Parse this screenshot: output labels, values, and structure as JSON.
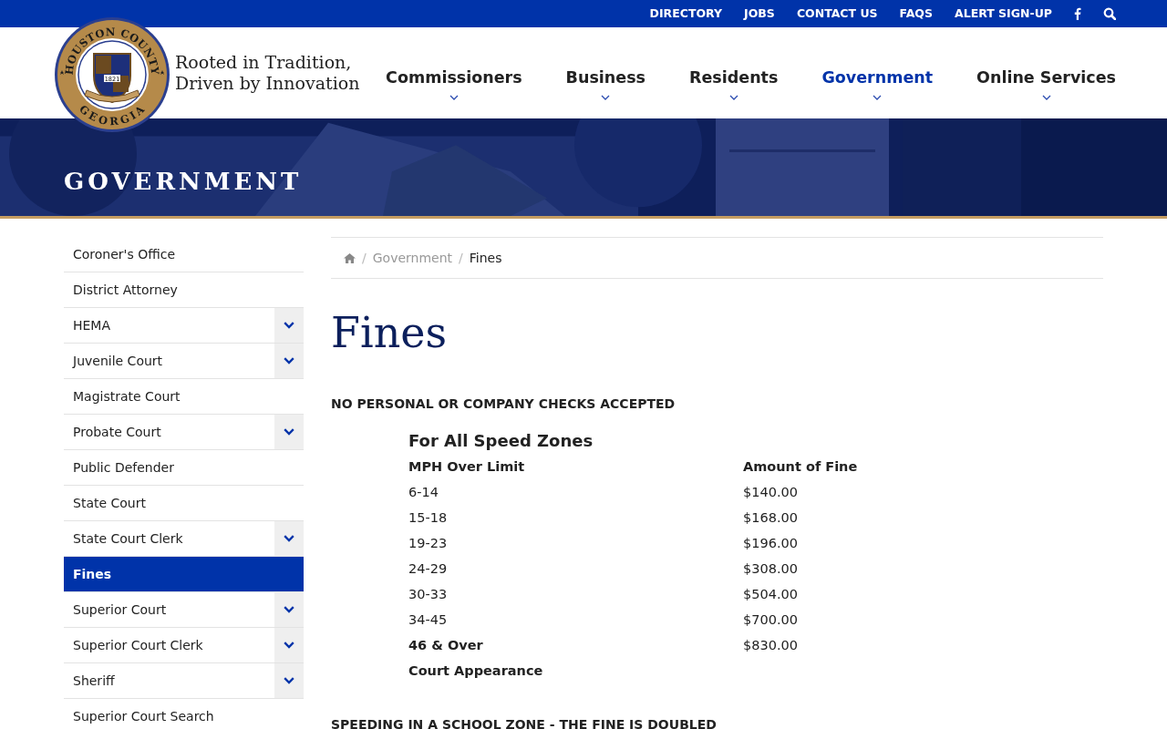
{
  "top_links": [
    {
      "kind": "text",
      "label": "DIRECTORY"
    },
    {
      "kind": "text",
      "label": "JOBS"
    },
    {
      "kind": "text",
      "label": "CONTACT US"
    },
    {
      "kind": "text",
      "label": "FAQS"
    },
    {
      "kind": "text",
      "label": "ALERT SIGN-UP"
    },
    {
      "kind": "facebook"
    },
    {
      "kind": "search"
    }
  ],
  "logo": {
    "ring_top": "HOUSTON COUNTY",
    "ring_bottom": "GEORGIA",
    "year": "1821"
  },
  "tagline": [
    "Rooted in Tradition,",
    "Driven by Innovation"
  ],
  "main_nav": [
    {
      "label": "Commissioners",
      "selected": false
    },
    {
      "label": "Business",
      "selected": false
    },
    {
      "label": "Residents",
      "selected": false
    },
    {
      "label": "Government",
      "selected": true
    },
    {
      "label": "Online Services",
      "selected": false
    }
  ],
  "banner": {
    "title": "GOVERNMENT",
    "kind": "picture"
  },
  "sidebar": {
    "items": [
      {
        "label": "Coroner's Office",
        "expandable": false,
        "selected": false
      },
      {
        "label": "District Attorney",
        "expandable": false,
        "selected": false
      },
      {
        "label": "HEMA",
        "expandable": true,
        "selected": false
      },
      {
        "label": "Juvenile Court",
        "expandable": true,
        "selected": false
      },
      {
        "label": "Magistrate Court",
        "expandable": false,
        "selected": false
      },
      {
        "label": "Probate Court",
        "expandable": true,
        "selected": false
      },
      {
        "label": "Public Defender",
        "expandable": false,
        "selected": false
      },
      {
        "label": "State Court",
        "expandable": false,
        "selected": false
      },
      {
        "label": "State Court Clerk",
        "expandable": true,
        "selected": false
      },
      {
        "label": "Fines",
        "expandable": false,
        "selected": true
      },
      {
        "label": "Superior Court",
        "expandable": true,
        "selected": false
      },
      {
        "label": "Superior Court Clerk",
        "expandable": true,
        "selected": false
      },
      {
        "label": "Sheriff",
        "expandable": true,
        "selected": false
      },
      {
        "label": "Superior Court Search",
        "expandable": false,
        "selected": false
      }
    ]
  },
  "breadcrumb": [
    "Government",
    "Fines"
  ],
  "breadcrumb_separator": "/",
  "page_title": "Fines",
  "notice": "NO PERSONAL OR COMPANY CHECKS ACCEPTED",
  "fine_table": {
    "title": "For All Speed Zones",
    "columns": [
      "MPH Over Limit",
      "Amount of Fine"
    ],
    "rows": [
      {
        "range": "6-14",
        "amount": "$140.00",
        "emphasis": false
      },
      {
        "range": "15-18",
        "amount": "$168.00",
        "emphasis": false
      },
      {
        "range": "19-23",
        "amount": "$196.00",
        "emphasis": false
      },
      {
        "range": "24-29",
        "amount": "$308.00",
        "emphasis": false
      },
      {
        "range": "30-33",
        "amount": "$504.00",
        "emphasis": false
      },
      {
        "range": "34-45",
        "amount": "$700.00",
        "emphasis": false
      },
      {
        "range": "46 & Over",
        "amount": "$830.00",
        "emphasis": true
      },
      {
        "range": "Court Appearance",
        "emphasis": true
      }
    ]
  },
  "footer_notice": "SPEEDING IN A SCHOOL ZONE - THE FINE IS DOUBLED"
}
